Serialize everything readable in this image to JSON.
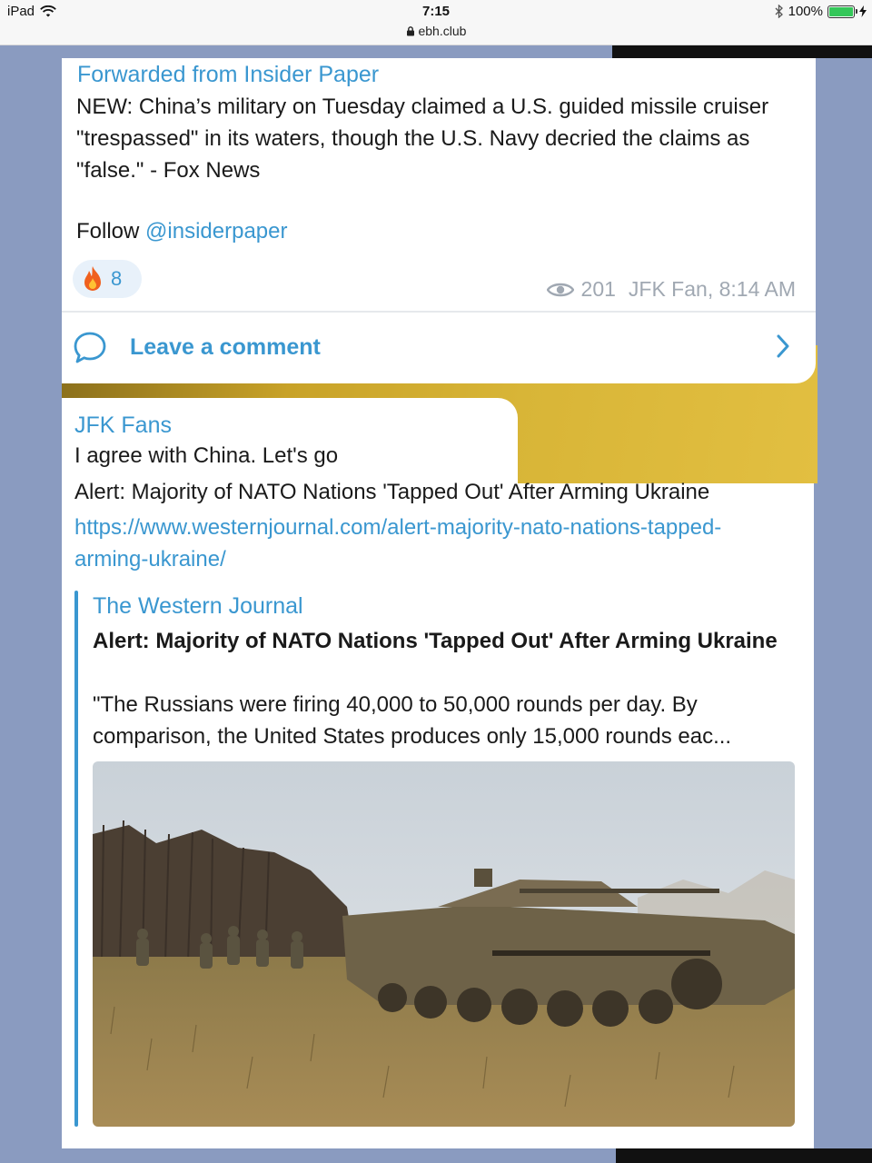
{
  "status_bar": {
    "device": "iPad",
    "time": "7:15",
    "url": "ebh.club",
    "battery": "100%"
  },
  "post1": {
    "forwarded_from": "Forwarded from Insider Paper",
    "text": "NEW: China’s military on Tuesday claimed a U.S. guided missile cruiser \"trespassed\" in its waters, though the U.S. Navy decried the claims as \"false.\" - Fox News",
    "follow_prefix": "Follow",
    "follow_handle": "@insiderpaper",
    "reaction_count": "8",
    "views": "201",
    "signature": "JFK Fan, 8:14 AM",
    "comment_label": "Leave a comment"
  },
  "post2": {
    "author": "JFK Fans",
    "text1": "I agree with China. Let's go",
    "text2": "Alert: Majority of NATO Nations 'Tapped Out' After Arming Ukraine",
    "url": "https://www.westernjournal.com/alert-majority-nato-nations-tapped-arming-ukraine/",
    "preview": {
      "site": "The Western Journal",
      "title": "Alert: Majority of NATO Nations 'Tapped Out' After Arming Ukraine",
      "description": "\"The Russians were firing 40,000 to 50,000 rounds per day. By comparison, the United States produces only 15,000 rounds eac..."
    }
  },
  "icons": [
    "wifi-icon",
    "lock-icon",
    "bluetooth-icon",
    "battery-icon",
    "fire-icon",
    "eye-icon",
    "comment-icon",
    "chevron-right-icon"
  ],
  "colors": {
    "accent": "#3a97d0",
    "background": "#8a9bc0",
    "wallpaper": "#d8b537"
  }
}
